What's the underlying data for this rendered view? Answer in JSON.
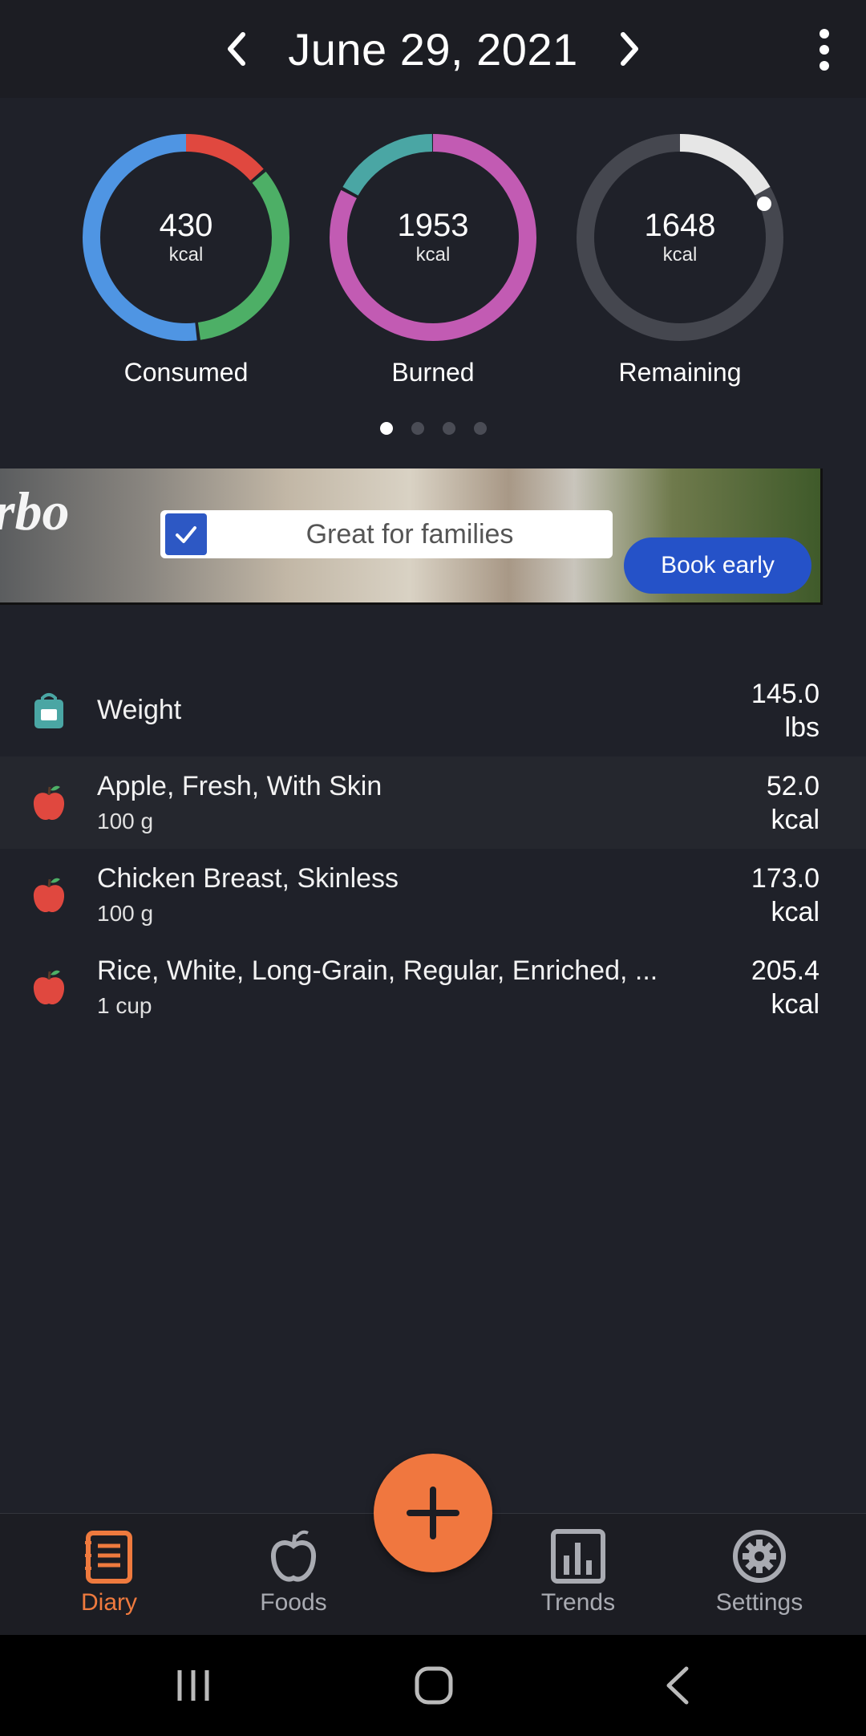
{
  "header": {
    "date": "June 29, 2021",
    "prev_icon": "chevron-left-icon",
    "next_icon": "chevron-right-icon",
    "menu_icon": "more-vertical-icon"
  },
  "summary": {
    "rings": [
      {
        "value": "430",
        "unit": "kcal",
        "label": "Consumed"
      },
      {
        "value": "1953",
        "unit": "kcal",
        "label": "Burned"
      },
      {
        "value": "1648",
        "unit": "kcal",
        "label": "Remaining"
      }
    ],
    "page_count": 4,
    "active_page": 0
  },
  "ad": {
    "brand": "rbo",
    "headline": "Great for families",
    "cta": "Book early"
  },
  "entries": [
    {
      "icon": "weight-scale-icon",
      "name": "Weight",
      "detail": "",
      "amount": "145.0",
      "unit": "lbs"
    },
    {
      "icon": "apple-icon",
      "name": "Apple, Fresh, With Skin",
      "detail": "100 g",
      "amount": "52.0",
      "unit": "kcal"
    },
    {
      "icon": "apple-icon",
      "name": "Chicken Breast, Skinless",
      "detail": "100 g",
      "amount": "173.0",
      "unit": "kcal"
    },
    {
      "icon": "apple-icon",
      "name": "Rice, White, Long-Grain, Regular, Enriched, ...",
      "detail": "1 cup",
      "amount": "205.4",
      "unit": "kcal"
    }
  ],
  "bottom_nav": {
    "tabs": [
      {
        "label": "Diary",
        "icon": "diary-icon"
      },
      {
        "label": "Foods",
        "icon": "apple-outline-icon"
      },
      {
        "label": "Trends",
        "icon": "bar-chart-icon"
      },
      {
        "label": "Settings",
        "icon": "gear-icon"
      }
    ],
    "active": "Diary",
    "fab_icon": "plus-icon"
  },
  "colors": {
    "accent": "#f0773f",
    "background": "#1f2129",
    "consumed_blue": "#4f95e3",
    "consumed_red": "#e0483f",
    "consumed_green": "#4daf66",
    "burned_magenta": "#c25bb3",
    "burned_teal": "#4aa6a4",
    "remaining_track": "#45474f",
    "remaining_progress": "#e6e6e6"
  }
}
